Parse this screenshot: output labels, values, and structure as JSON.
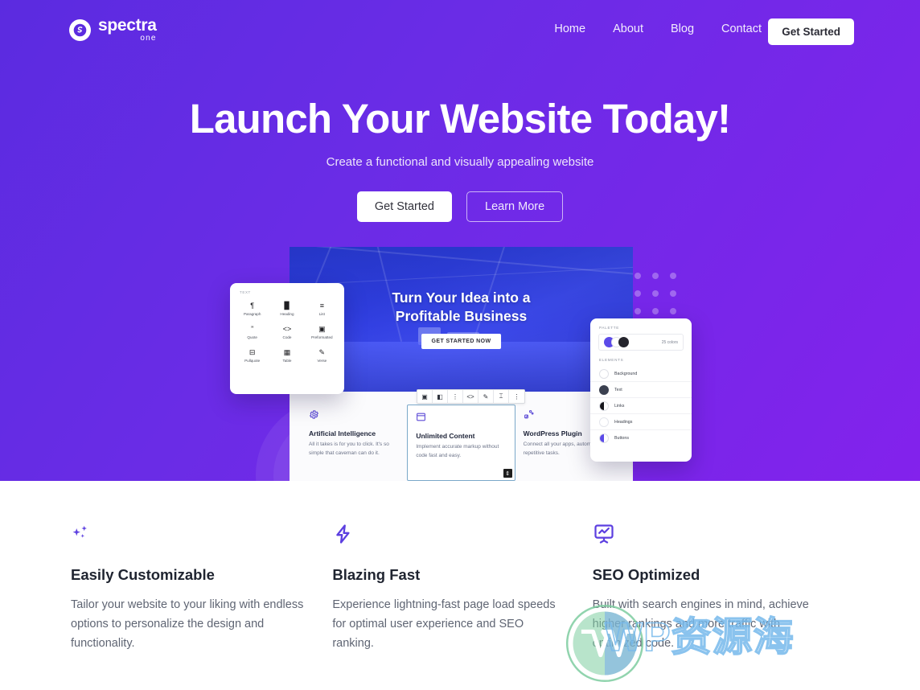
{
  "brand": {
    "name": "spectra",
    "sub": "one",
    "logo_icon": "spectra-s-logo-icon",
    "accent": "#5b2be0",
    "accent_alt": "#8322ec"
  },
  "nav": {
    "links": [
      {
        "label": "Home",
        "name": "nav-link-home"
      },
      {
        "label": "About",
        "name": "nav-link-about"
      },
      {
        "label": "Blog",
        "name": "nav-link-blog"
      },
      {
        "label": "Contact",
        "name": "nav-link-contact"
      }
    ],
    "cta_label": "Get Started"
  },
  "hero": {
    "title": "Launch Your Website Today!",
    "subtitle": "Create a functional and visually appealing website",
    "primary_button": "Get Started",
    "secondary_button": "Learn More"
  },
  "mock": {
    "banner_line1": "Turn Your Idea into a",
    "banner_line2": "Profitable Business",
    "banner_button": "GET STARTED NOW",
    "cards": [
      {
        "title": "Artificial Intelligence",
        "text": "All it takes is for you to click. It's so simple that caveman can do it.",
        "icon": "gear-icon",
        "selected": false
      },
      {
        "title": "Unlimited Content",
        "text": "Implement accurate markup without code fast and easy.",
        "icon": "browser-window-icon",
        "selected": true
      },
      {
        "title": "WordPress Plugin",
        "text": "Connect all your apps, automate repetitive tasks.",
        "icon": "plugin-icon",
        "selected": false
      }
    ],
    "toolbar_icons": [
      "block-type-icon",
      "alignment-icon",
      "drag-handle-icon",
      "inline-code-icon",
      "link-icon",
      "text-color-icon",
      "more-options-icon"
    ]
  },
  "inserter": {
    "section_label": "TEXT",
    "blocks": [
      {
        "label": "Paragraph",
        "icon": "paragraph-icon",
        "glyph": "¶"
      },
      {
        "label": "Heading",
        "icon": "heading-icon",
        "glyph": "▉"
      },
      {
        "label": "List",
        "icon": "list-icon",
        "glyph": "≡"
      },
      {
        "label": "Quote",
        "icon": "quote-icon",
        "glyph": "”"
      },
      {
        "label": "Code",
        "icon": "code-icon",
        "glyph": "<>"
      },
      {
        "label": "Preformatted",
        "icon": "preformatted-icon",
        "glyph": "▣"
      },
      {
        "label": "Pullquote",
        "icon": "pullquote-icon",
        "glyph": "⊟"
      },
      {
        "label": "Table",
        "icon": "table-icon",
        "glyph": "▦"
      },
      {
        "label": "Verse",
        "icon": "verse-icon",
        "glyph": "✎"
      }
    ]
  },
  "palette": {
    "header": "PALETTE",
    "color_count": "25 colors",
    "elements_header": "ELEMENTS",
    "elements": [
      {
        "label": "Background",
        "swatch": "background-swatch",
        "style": "empty"
      },
      {
        "label": "Text",
        "swatch": "text-swatch",
        "style": "dark"
      },
      {
        "label": "Links",
        "swatch": "links-swatch",
        "style": "half-dark"
      },
      {
        "label": "Headings",
        "swatch": "headings-swatch",
        "style": "outline"
      },
      {
        "label": "Buttons",
        "swatch": "buttons-swatch",
        "style": "half-blue"
      }
    ]
  },
  "features": [
    {
      "title": "Easily Customizable",
      "text": "Tailor your website to your liking with endless options to personalize the design and functionality.",
      "icon": "sparkles-icon"
    },
    {
      "title": "Blazing Fast",
      "text": "Experience lightning-fast page load speeds for optimal user experience and SEO ranking.",
      "icon": "lightning-bolt-icon"
    },
    {
      "title": "SEO Optimized",
      "text": "Built with search engines in mind, achieve higher rankings and more traffic with optimized code.",
      "icon": "chart-board-icon"
    }
  ],
  "watermark": {
    "text": "WP资源海",
    "logo_icon": "wordpress-logo-icon"
  }
}
